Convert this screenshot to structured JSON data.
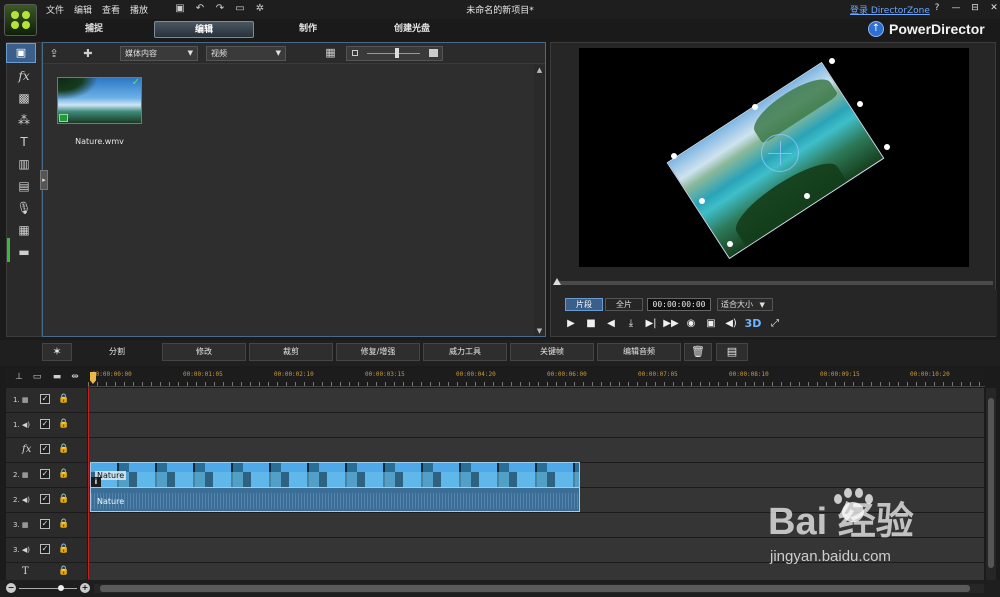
{
  "titlebar": {
    "menu": [
      "文件",
      "编辑",
      "查看",
      "播放"
    ],
    "toolbar_icons": [
      "save-icon",
      "undo-icon",
      "redo-icon",
      "fit-icon",
      "settings-icon"
    ],
    "doc_title": "未命名的新项目*",
    "login_link": "登录 DirectorZone",
    "window_buttons": [
      "?",
      "—",
      "⊟",
      "✕"
    ]
  },
  "mode_tabs": [
    {
      "label": "捕捉",
      "active": false
    },
    {
      "label": "编辑",
      "active": true
    },
    {
      "label": "制作",
      "active": false
    },
    {
      "label": "创建光盘",
      "active": false
    }
  ],
  "brand": {
    "name": "PowerDirector",
    "icon": "upgrade-arrow-icon",
    "accent": "#2f6fd1"
  },
  "left_rail": [
    "media-room-icon",
    "fx-icon",
    "pip-objects-icon",
    "particle-icon",
    "title-icon",
    "transition-icon",
    "audio-mixing-icon",
    "voice-over-icon",
    "chapter-icon",
    "subtitle-icon"
  ],
  "library": {
    "content_dropdown": "媒体内容",
    "type_dropdown": "视频",
    "items": [
      {
        "name": "Nature.wmv",
        "checked": true
      }
    ]
  },
  "preview": {
    "mode_clip": "片段",
    "mode_movie": "全片",
    "timecode": "00:00:00:00",
    "fit": "适合大小",
    "controls": [
      "▶",
      "■",
      "◀",
      "⤓",
      "▶|",
      "▶▶",
      "◉",
      "▣",
      "◀)",
      "3D",
      "⤢"
    ]
  },
  "timeline_toolbar": {
    "magic_icon": "magic-wand-icon",
    "buttons": [
      "分割",
      "修改",
      "裁剪",
      "修复/增强",
      "威力工具",
      "关键帧",
      "编辑音频"
    ],
    "delete_icon": "trash-icon",
    "more_icon": "more-icon"
  },
  "ruler": {
    "labels": [
      "00:00:00:00",
      "00:00:01:05",
      "00:00:02:10",
      "00:00:03:15",
      "00:00:04:20",
      "00:00:06:00",
      "00:00:07:05",
      "00:00:08:10",
      "00:00:09:15",
      "00:00:10:20"
    ],
    "color": "#c99a3a"
  },
  "tracks": [
    {
      "id": "1.",
      "kind": "video"
    },
    {
      "id": "1.",
      "kind": "audio"
    },
    {
      "id": "fx",
      "kind": "fx"
    },
    {
      "id": "2.",
      "kind": "video"
    },
    {
      "id": "2.",
      "kind": "audio"
    },
    {
      "id": "3.",
      "kind": "video"
    },
    {
      "id": "3.",
      "kind": "audio"
    },
    {
      "id": "T",
      "kind": "title"
    }
  ],
  "clips": {
    "video": {
      "label": "Nature",
      "info": "i"
    },
    "audio": {
      "label": "Nature"
    }
  },
  "watermark": {
    "brand": "Bai 经验",
    "url": "jingyan.baidu.com"
  }
}
